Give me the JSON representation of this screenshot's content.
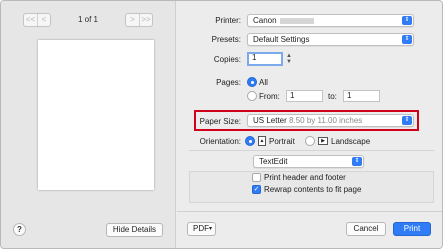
{
  "preview": {
    "page_count": "1 of 1",
    "nav_first": "<<",
    "nav_prev": "<",
    "nav_next": ">",
    "nav_last": ">>",
    "help_label": "?",
    "hide_details_label": "Hide Details"
  },
  "printer": {
    "label": "Printer:",
    "value": "Canon"
  },
  "presets": {
    "label": "Presets:",
    "value": "Default Settings"
  },
  "copies": {
    "label": "Copies:",
    "value": "1"
  },
  "pages": {
    "label": "Pages:",
    "all_label": "All",
    "from_label": "From:",
    "from_value": "1",
    "to_label": "to:",
    "to_value": "1",
    "selected": "All"
  },
  "paper_size": {
    "label": "Paper Size:",
    "value": "US Letter",
    "detail": "8.50 by 11.00 inches"
  },
  "orientation": {
    "label": "Orientation:",
    "portrait_label": "Portrait",
    "landscape_label": "Landscape",
    "selected": "Portrait"
  },
  "app_section": {
    "value": "TextEdit"
  },
  "options": {
    "print_header": {
      "label": "Print header and footer",
      "checked": false
    },
    "rewrap": {
      "label": "Rewrap contents to fit page",
      "checked": true
    }
  },
  "footer": {
    "pdf_label": "PDF",
    "cancel_label": "Cancel",
    "print_label": "Print"
  },
  "colors": {
    "accent": "#2f7cf6",
    "highlight": "#d0021b"
  }
}
